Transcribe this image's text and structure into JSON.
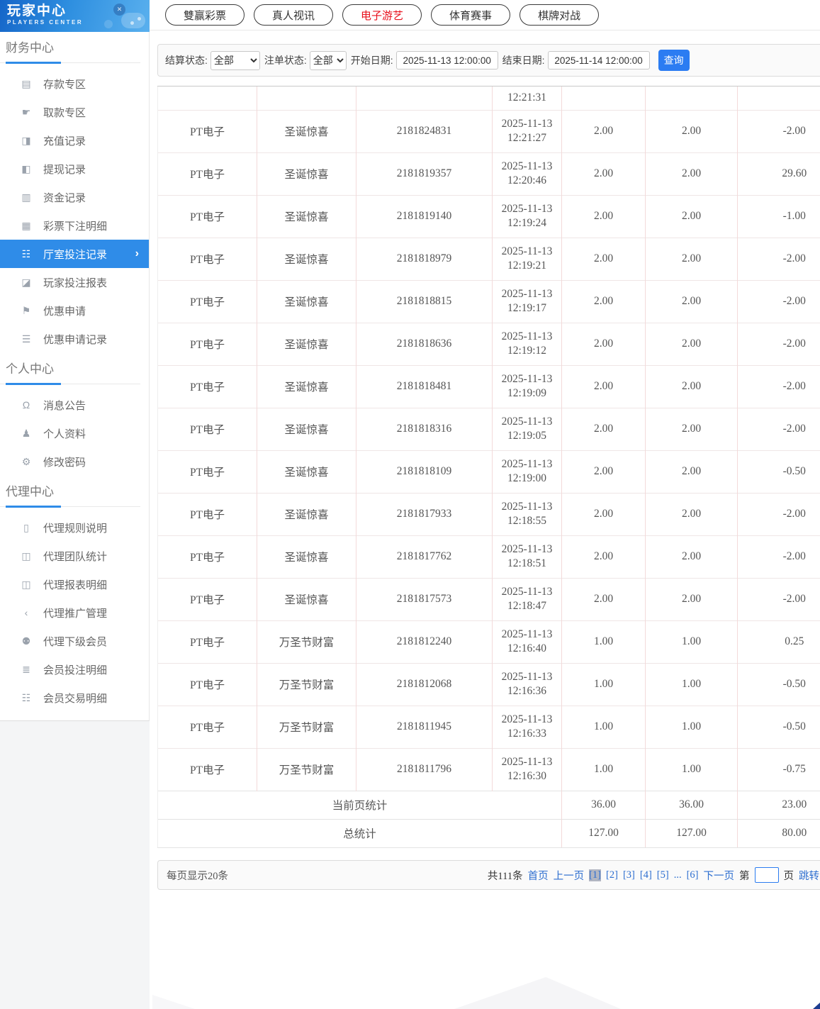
{
  "logo": {
    "title": "玩家中心",
    "subtitle": "PLAYERS CENTER"
  },
  "top_nav": {
    "tabs": [
      {
        "label": "雙赢彩票",
        "active": false
      },
      {
        "label": "真人视讯",
        "active": false
      },
      {
        "label": "电子游艺",
        "active": true
      },
      {
        "label": "体育赛事",
        "active": false
      },
      {
        "label": "棋牌对战",
        "active": false
      }
    ]
  },
  "filters": {
    "settle_status_label": "结算状态:",
    "settle_status_value": "全部",
    "order_status_label": "注单状态:",
    "order_status_value": "全部",
    "start_date_label": "开始日期:",
    "start_date_value": "2025-11-13 12:00:00",
    "end_date_label": "结束日期:",
    "end_date_value": "2025-11-14 12:00:00",
    "search_button": "查询"
  },
  "sidebar": {
    "sections": [
      {
        "title": "财务中心",
        "items": [
          {
            "label": "存款专区",
            "icon": "deposit-card-icon",
            "active": false
          },
          {
            "label": "取款专区",
            "icon": "withdraw-hand-icon",
            "active": false
          },
          {
            "label": "充值记录",
            "icon": "recharge-record-icon",
            "active": false
          },
          {
            "label": "提现记录",
            "icon": "withdraw-record-icon",
            "active": false
          },
          {
            "label": "资金记录",
            "icon": "funds-record-icon",
            "active": false
          },
          {
            "label": "彩票下注明细",
            "icon": "lottery-bet-detail-icon",
            "active": false
          },
          {
            "label": "厅室投注记录",
            "icon": "hall-bet-record-icon",
            "active": true
          },
          {
            "label": "玩家投注报表",
            "icon": "player-bet-report-icon",
            "active": false
          },
          {
            "label": "优惠申请",
            "icon": "promo-apply-icon",
            "active": false
          },
          {
            "label": "优惠申请记录",
            "icon": "promo-apply-record-icon",
            "active": false
          }
        ]
      },
      {
        "title": "个人中心",
        "items": [
          {
            "label": "消息公告",
            "icon": "bell-icon",
            "active": false
          },
          {
            "label": "个人资料",
            "icon": "user-icon",
            "active": false
          },
          {
            "label": "修改密码",
            "icon": "gear-icon",
            "active": false
          }
        ]
      },
      {
        "title": "代理中心",
        "items": [
          {
            "label": "代理规则说明",
            "icon": "document-icon",
            "active": false
          },
          {
            "label": "代理团队统计",
            "icon": "team-stats-icon",
            "active": false
          },
          {
            "label": "代理报表明细",
            "icon": "report-detail-icon",
            "active": false
          },
          {
            "label": "代理推广管理",
            "icon": "share-icon",
            "active": false
          },
          {
            "label": "代理下级会员",
            "icon": "members-icon",
            "active": false
          },
          {
            "label": "会员投注明细",
            "icon": "member-bet-detail-icon",
            "active": false
          },
          {
            "label": "会员交易明细",
            "icon": "member-trade-detail-icon",
            "active": false
          }
        ]
      }
    ]
  },
  "table": {
    "partial_row": {
      "time": "12:21:31"
    },
    "rows": [
      {
        "platform": "PT电子",
        "game": "圣诞惊喜",
        "order": "2181824831",
        "date": "2025-11-13",
        "time": "12:21:27",
        "bet": "2.00",
        "valid": "2.00",
        "profit": "-2.00"
      },
      {
        "platform": "PT电子",
        "game": "圣诞惊喜",
        "order": "2181819357",
        "date": "2025-11-13",
        "time": "12:20:46",
        "bet": "2.00",
        "valid": "2.00",
        "profit": "29.60"
      },
      {
        "platform": "PT电子",
        "game": "圣诞惊喜",
        "order": "2181819140",
        "date": "2025-11-13",
        "time": "12:19:24",
        "bet": "2.00",
        "valid": "2.00",
        "profit": "-1.00"
      },
      {
        "platform": "PT电子",
        "game": "圣诞惊喜",
        "order": "2181818979",
        "date": "2025-11-13",
        "time": "12:19:21",
        "bet": "2.00",
        "valid": "2.00",
        "profit": "-2.00"
      },
      {
        "platform": "PT电子",
        "game": "圣诞惊喜",
        "order": "2181818815",
        "date": "2025-11-13",
        "time": "12:19:17",
        "bet": "2.00",
        "valid": "2.00",
        "profit": "-2.00"
      },
      {
        "platform": "PT电子",
        "game": "圣诞惊喜",
        "order": "2181818636",
        "date": "2025-11-13",
        "time": "12:19:12",
        "bet": "2.00",
        "valid": "2.00",
        "profit": "-2.00"
      },
      {
        "platform": "PT电子",
        "game": "圣诞惊喜",
        "order": "2181818481",
        "date": "2025-11-13",
        "time": "12:19:09",
        "bet": "2.00",
        "valid": "2.00",
        "profit": "-2.00"
      },
      {
        "platform": "PT电子",
        "game": "圣诞惊喜",
        "order": "2181818316",
        "date": "2025-11-13",
        "time": "12:19:05",
        "bet": "2.00",
        "valid": "2.00",
        "profit": "-2.00"
      },
      {
        "platform": "PT电子",
        "game": "圣诞惊喜",
        "order": "2181818109",
        "date": "2025-11-13",
        "time": "12:19:00",
        "bet": "2.00",
        "valid": "2.00",
        "profit": "-0.50"
      },
      {
        "platform": "PT电子",
        "game": "圣诞惊喜",
        "order": "2181817933",
        "date": "2025-11-13",
        "time": "12:18:55",
        "bet": "2.00",
        "valid": "2.00",
        "profit": "-2.00"
      },
      {
        "platform": "PT电子",
        "game": "圣诞惊喜",
        "order": "2181817762",
        "date": "2025-11-13",
        "time": "12:18:51",
        "bet": "2.00",
        "valid": "2.00",
        "profit": "-2.00"
      },
      {
        "platform": "PT电子",
        "game": "圣诞惊喜",
        "order": "2181817573",
        "date": "2025-11-13",
        "time": "12:18:47",
        "bet": "2.00",
        "valid": "2.00",
        "profit": "-2.00"
      },
      {
        "platform": "PT电子",
        "game": "万圣节财富",
        "order": "2181812240",
        "date": "2025-11-13",
        "time": "12:16:40",
        "bet": "1.00",
        "valid": "1.00",
        "profit": "0.25"
      },
      {
        "platform": "PT电子",
        "game": "万圣节财富",
        "order": "2181812068",
        "date": "2025-11-13",
        "time": "12:16:36",
        "bet": "1.00",
        "valid": "1.00",
        "profit": "-0.50"
      },
      {
        "platform": "PT电子",
        "game": "万圣节财富",
        "order": "2181811945",
        "date": "2025-11-13",
        "time": "12:16:33",
        "bet": "1.00",
        "valid": "1.00",
        "profit": "-0.50"
      },
      {
        "platform": "PT电子",
        "game": "万圣节财富",
        "order": "2181811796",
        "date": "2025-11-13",
        "time": "12:16:30",
        "bet": "1.00",
        "valid": "1.00",
        "profit": "-0.75"
      }
    ],
    "page_stats": {
      "label": "当前页统计",
      "bet": "36.00",
      "valid": "36.00",
      "profit": "23.00"
    },
    "total_stats": {
      "label": "总统计",
      "bet": "127.00",
      "valid": "127.00",
      "profit": "80.00"
    }
  },
  "pagination": {
    "page_size_text": "每页显示20条",
    "total_text": "共111条",
    "first": "首页",
    "prev": "上一页",
    "pages": [
      {
        "label": "[1]",
        "active": true
      },
      {
        "label": "[2]",
        "active": false
      },
      {
        "label": "[3]",
        "active": false
      },
      {
        "label": "[4]",
        "active": false
      },
      {
        "label": "[5]",
        "active": false
      },
      {
        "label": "...",
        "active": false
      },
      {
        "label": "[6]",
        "active": false
      }
    ],
    "next": "下一页",
    "jump_prefix": "第",
    "jump_suffix": "页",
    "jump_button": "跳转"
  },
  "colors": {
    "sidebar_active_bg": "#2f8ce8",
    "search_button_bg": "#2b7cf2",
    "active_tab_text": "#e8101c",
    "link_blue": "#2e6fd0",
    "current_page_bg": "#b2b6c2",
    "table_divider_pink": "#f3dada",
    "logo_gradient_start": "#1565c8",
    "logo_gradient_end": "#5ab0ee"
  }
}
